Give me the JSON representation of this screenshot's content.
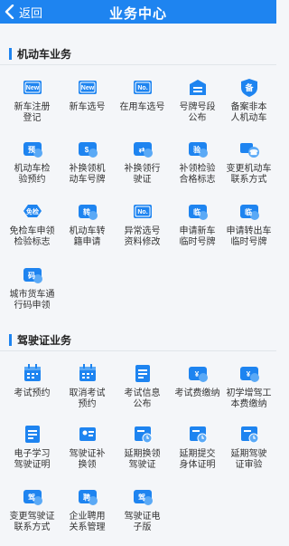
{
  "header": {
    "back_label": "返回",
    "title": "业务中心"
  },
  "colors": {
    "accent": "#1e84f0",
    "icon_light": "#5aa9f6"
  },
  "vehicle": {
    "title": "机动车业务",
    "items": [
      {
        "label": "新车注册\n登记",
        "icon": "new-plate-icon",
        "glyph": "New"
      },
      {
        "label": "新车选号",
        "icon": "new-plate-select-icon",
        "glyph": "New"
      },
      {
        "label": "在用车选号",
        "icon": "in-use-plate-icon",
        "glyph": "No."
      },
      {
        "label": "号牌号段\n公布",
        "icon": "plate-segment-icon",
        "glyph": "="
      },
      {
        "label": "备案非本\n人机动车",
        "icon": "shield-record-icon",
        "glyph": "备"
      },
      {
        "label": "机动车检\n验预约",
        "icon": "inspection-appointment-icon",
        "glyph": "预"
      },
      {
        "label": "补换领机\n动车号牌",
        "icon": "plate-replace-icon",
        "glyph": "$"
      },
      {
        "label": "补换领行\n驶证",
        "icon": "license-replace-icon",
        "glyph": "⇄"
      },
      {
        "label": "补领检验\n合格标志",
        "icon": "inspection-badge-icon",
        "glyph": "验"
      },
      {
        "label": "变更机动车\n联系方式",
        "icon": "vehicle-contact-icon",
        "glyph": "☎"
      },
      {
        "label": "免检车申领\n检验标志",
        "icon": "exempt-inspection-icon",
        "glyph": "免检"
      },
      {
        "label": "机动车转\n籍申请",
        "icon": "vehicle-transfer-icon",
        "glyph": "转"
      },
      {
        "label": "异常选号\n资料修改",
        "icon": "abnormal-plate-icon",
        "glyph": "No."
      },
      {
        "label": "申请新车\n临时号牌",
        "icon": "new-temp-plate-icon",
        "glyph": "临"
      },
      {
        "label": "申请转出车\n临时号牌",
        "icon": "transfer-temp-plate-icon",
        "glyph": "临"
      },
      {
        "label": "城市货车通\n行码申领",
        "icon": "truck-pass-icon",
        "glyph": "码"
      }
    ]
  },
  "driver": {
    "title": "驾驶证业务",
    "items": [
      {
        "label": "考试预约",
        "icon": "exam-appointment-icon",
        "glyph": "cal"
      },
      {
        "label": "取消考试\n预约",
        "icon": "cancel-exam-icon",
        "glyph": "cal"
      },
      {
        "label": "考试信息\n公布",
        "icon": "exam-info-icon",
        "glyph": "doc"
      },
      {
        "label": "考试费缴纳",
        "icon": "exam-fee-icon",
        "glyph": "¥"
      },
      {
        "label": "初学增驾工\n本费缴纳",
        "icon": "fee-payment-icon",
        "glyph": "¥"
      },
      {
        "label": "电子学习\n驾驶证明",
        "icon": "e-learning-icon",
        "glyph": "doc"
      },
      {
        "label": "驾驶证补\n换领",
        "icon": "license-renew-icon",
        "glyph": "id"
      },
      {
        "label": "延期换领\n驾驶证",
        "icon": "delay-renew-icon",
        "glyph": "clock"
      },
      {
        "label": "延期提交\n身体证明",
        "icon": "delay-health-icon",
        "glyph": "clock"
      },
      {
        "label": "延期驾驶\n证审验",
        "icon": "delay-review-icon",
        "glyph": "clock"
      },
      {
        "label": "变更驾驶证\n联系方式",
        "icon": "driver-contact-icon",
        "glyph": "驾"
      },
      {
        "label": "企业聘用\n关系管理",
        "icon": "enterprise-employ-icon",
        "glyph": "聘"
      },
      {
        "label": "驾驶证电\n子版",
        "icon": "e-license-icon",
        "glyph": "驾"
      }
    ]
  }
}
